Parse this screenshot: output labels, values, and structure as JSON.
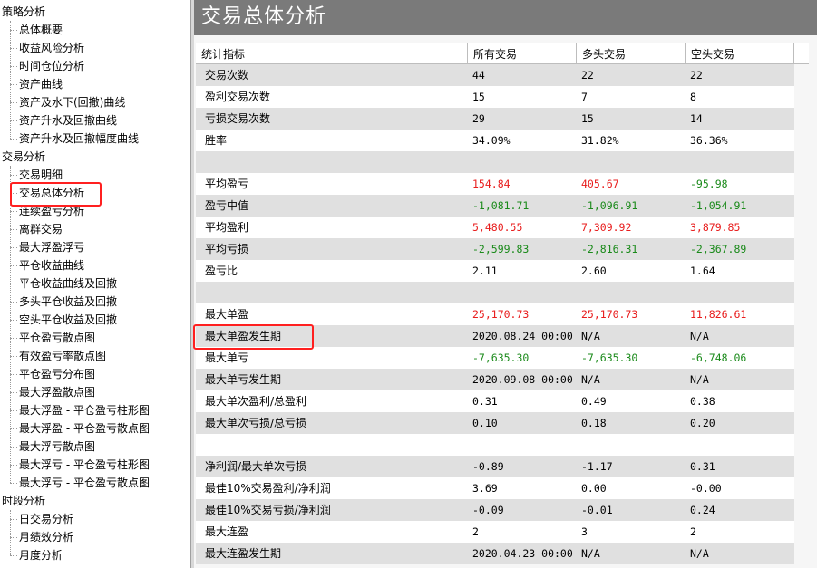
{
  "sidebar": {
    "sections": [
      {
        "label": "策略分析",
        "items": [
          "总体概要",
          "收益风险分析",
          "时间仓位分析",
          "资产曲线",
          "资产及水下(回撤)曲线",
          "资产升水及回撤曲线",
          "资产升水及回撤幅度曲线"
        ]
      },
      {
        "label": "交易分析",
        "items": [
          "交易明细",
          "交易总体分析",
          "连续盈亏分析",
          "离群交易",
          "最大浮盈浮亏",
          "平仓收益曲线",
          "平仓收益曲线及回撤",
          "多头平仓收益及回撤",
          "空头平仓收益及回撤",
          "平仓盈亏散点图",
          "有效盈亏率散点图",
          "平仓盈亏分布图",
          "最大浮盈散点图",
          "最大浮盈 - 平仓盈亏柱形图",
          "最大浮盈 - 平仓盈亏散点图",
          "最大浮亏散点图",
          "最大浮亏 - 平仓盈亏柱形图",
          "最大浮亏 - 平仓盈亏散点图"
        ]
      },
      {
        "label": "时段分析",
        "items": [
          "日交易分析",
          "月绩效分析",
          "月度分析"
        ]
      }
    ],
    "selected": "交易总体分析"
  },
  "main": {
    "title": "交易总体分析",
    "columns": [
      "统计指标",
      "所有交易",
      "多头交易",
      "空头交易"
    ],
    "rows": [
      {
        "label": "交易次数",
        "all": "44",
        "long": "22",
        "short": "22"
      },
      {
        "label": "盈利交易次数",
        "all": "15",
        "long": "7",
        "short": "8"
      },
      {
        "label": "亏损交易次数",
        "all": "29",
        "long": "15",
        "short": "14"
      },
      {
        "label": "胜率",
        "all": "34.09%",
        "long": "31.82%",
        "short": "36.36%"
      },
      {
        "label": "",
        "all": "",
        "long": "",
        "short": ""
      },
      {
        "label": "平均盈亏",
        "all": "154.84",
        "long": "405.67",
        "short": "-95.98"
      },
      {
        "label": "盈亏中值",
        "all": "-1,081.71",
        "long": "-1,096.91",
        "short": "-1,054.91"
      },
      {
        "label": "平均盈利",
        "all": "5,480.55",
        "long": "7,309.92",
        "short": "3,879.85"
      },
      {
        "label": "平均亏损",
        "all": "-2,599.83",
        "long": "-2,816.31",
        "short": "-2,367.89"
      },
      {
        "label": "盈亏比",
        "all": "2.11",
        "long": "2.60",
        "short": "1.64"
      },
      {
        "label": "",
        "all": "",
        "long": "",
        "short": ""
      },
      {
        "label": "最大单盈",
        "all": "25,170.73",
        "long": "25,170.73",
        "short": "11,826.61"
      },
      {
        "label": "最大单盈发生期",
        "all": "2020.08.24 00:00",
        "long": "N/A",
        "short": "N/A"
      },
      {
        "label": "最大单亏",
        "all": "-7,635.30",
        "long": "-7,635.30",
        "short": "-6,748.06"
      },
      {
        "label": "最大单亏发生期",
        "all": "2020.09.08 00:00",
        "long": "N/A",
        "short": "N/A"
      },
      {
        "label": "最大单次盈利/总盈利",
        "all": "0.31",
        "long": "0.49",
        "short": "0.38"
      },
      {
        "label": "最大单次亏损/总亏损",
        "all": "0.10",
        "long": "0.18",
        "short": "0.20"
      },
      {
        "label": "",
        "all": "",
        "long": "",
        "short": ""
      },
      {
        "label": "净利润/最大单次亏损",
        "all": "-0.89",
        "long": "-1.17",
        "short": "0.31"
      },
      {
        "label": "最佳10%交易盈利/净利润",
        "all": "3.69",
        "long": "0.00",
        "short": "-0.00"
      },
      {
        "label": "最佳10%交易亏损/净利润",
        "all": "-0.09",
        "long": "-0.01",
        "short": "0.24"
      },
      {
        "label": "最大连盈",
        "all": "2",
        "long": "3",
        "short": "2"
      },
      {
        "label": "最大连盈发生期",
        "all": "2020.04.23 00:00",
        "long": "N/A",
        "short": "N/A"
      }
    ]
  },
  "colors": {
    "title_bar": "#7a7a7a",
    "positive": "#e81c1c",
    "negative": "#1a8a1a",
    "highlight": "#ff2020",
    "row_shade": "#e0e0e0"
  }
}
